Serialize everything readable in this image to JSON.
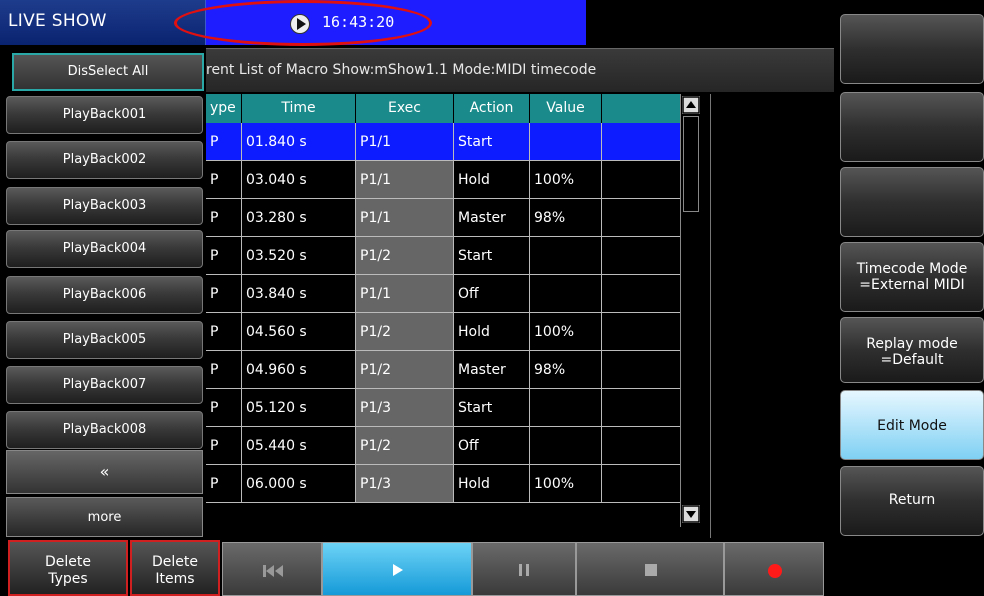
{
  "header": {
    "title": "LIVE SHOW",
    "clock": "16:43:20"
  },
  "info_bar": {
    "text": "rent List of Macro Show:mShow1.1  Mode:MIDI timecode"
  },
  "left_panel": {
    "deselect_label": "DisSelect All",
    "playbacks": [
      "PlayBack001",
      "PlayBack002",
      "PlayBack003",
      "PlayBack004",
      "PlayBack006",
      "PlayBack005",
      "PlayBack007",
      "PlayBack008"
    ],
    "back_label": "«",
    "more_label": "more"
  },
  "table": {
    "columns": [
      "ype",
      "Time",
      "Exec",
      "Action",
      "Value"
    ],
    "rows": [
      {
        "type": "P",
        "time": "01.840 s",
        "exec": "P1/1",
        "action": "Start",
        "value": ""
      },
      {
        "type": "P",
        "time": "03.040 s",
        "exec": "P1/1",
        "action": "Hold",
        "value": "100%"
      },
      {
        "type": "P",
        "time": "03.280 s",
        "exec": "P1/1",
        "action": "Master",
        "value": "98%"
      },
      {
        "type": "P",
        "time": "03.520 s",
        "exec": "P1/2",
        "action": "Start",
        "value": ""
      },
      {
        "type": "P",
        "time": "03.840 s",
        "exec": "P1/1",
        "action": "Off",
        "value": ""
      },
      {
        "type": "P",
        "time": "04.560 s",
        "exec": "P1/2",
        "action": "Hold",
        "value": "100%"
      },
      {
        "type": "P",
        "time": "04.960 s",
        "exec": "P1/2",
        "action": "Master",
        "value": "98%"
      },
      {
        "type": "P",
        "time": "05.120 s",
        "exec": "P1/3",
        "action": "Start",
        "value": ""
      },
      {
        "type": "P",
        "time": "05.440 s",
        "exec": "P1/2",
        "action": "Off",
        "value": ""
      },
      {
        "type": "P",
        "time": "06.000 s",
        "exec": "P1/3",
        "action": "Hold",
        "value": "100%"
      }
    ],
    "selected_row": 0
  },
  "right_panel": {
    "timecode_mode_line1": "Timecode Mode",
    "timecode_mode_line2": "=External MIDI",
    "replay_mode_line1": "Replay mode",
    "replay_mode_line2": "=Default",
    "edit_mode": "Edit Mode",
    "return": "Return"
  },
  "bottom_bar": {
    "delete_types_line1": "Delete",
    "delete_types_line2": "Types",
    "delete_items_line1": "Delete",
    "delete_items_line2": "Items"
  },
  "colors": {
    "accent_blue": "#1d1dff",
    "table_header": "#1a8a8a",
    "highlight_oval": "#e01010",
    "record_red": "#ff1a1a",
    "edit_mode_light": "#7fd0f3"
  },
  "icons": [
    "play-circle-icon",
    "skip-back-icon",
    "play-icon",
    "pause-icon",
    "stop-icon",
    "record-icon",
    "scroll-up-icon",
    "scroll-down-icon"
  ]
}
